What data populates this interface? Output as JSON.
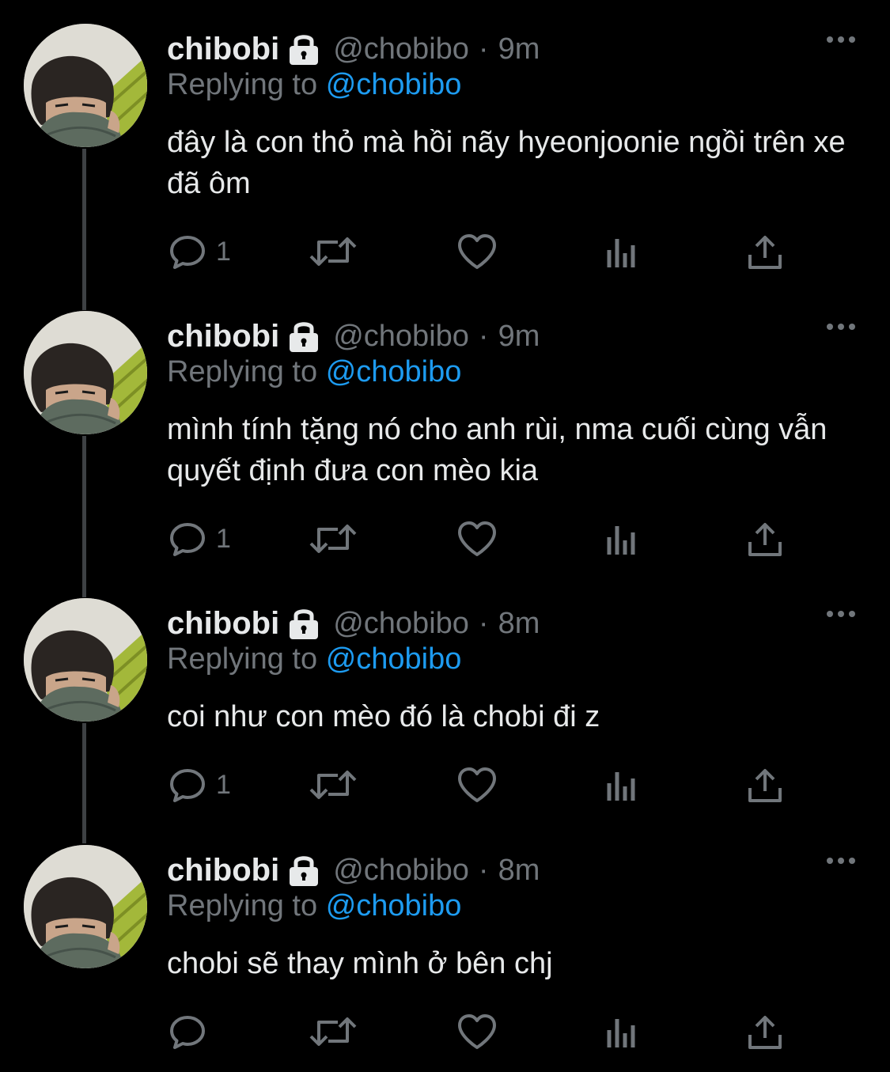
{
  "accent_color": "#1d9bf0",
  "muted_color": "#71767b",
  "tweets": [
    {
      "name": "chibobi",
      "handle": "@chobibo",
      "separator": "·",
      "time": "9m",
      "replying_prefix": "Replying to",
      "replying_to": "@chobibo",
      "text": "đây là con thỏ mà hồi nãy hyeonjoonie ngồi trên xe đã ôm",
      "reply_count": "1"
    },
    {
      "name": "chibobi",
      "handle": "@chobibo",
      "separator": "·",
      "time": "9m",
      "replying_prefix": "Replying to",
      "replying_to": "@chobibo",
      "text": "mình tính tặng nó cho anh rùi, nma cuối cùng vẫn quyết định đưa con mèo kia",
      "reply_count": "1"
    },
    {
      "name": "chibobi",
      "handle": "@chobibo",
      "separator": "·",
      "time": "8m",
      "replying_prefix": "Replying to",
      "replying_to": "@chobibo",
      "text": "coi như con mèo đó là chobi đi z",
      "reply_count": "1"
    },
    {
      "name": "chibobi",
      "handle": "@chobibo",
      "separator": "·",
      "time": "8m",
      "replying_prefix": "Replying to",
      "replying_to": "@chobibo",
      "text": "chobi sẽ thay mình ở bên chj",
      "reply_count": ""
    }
  ]
}
